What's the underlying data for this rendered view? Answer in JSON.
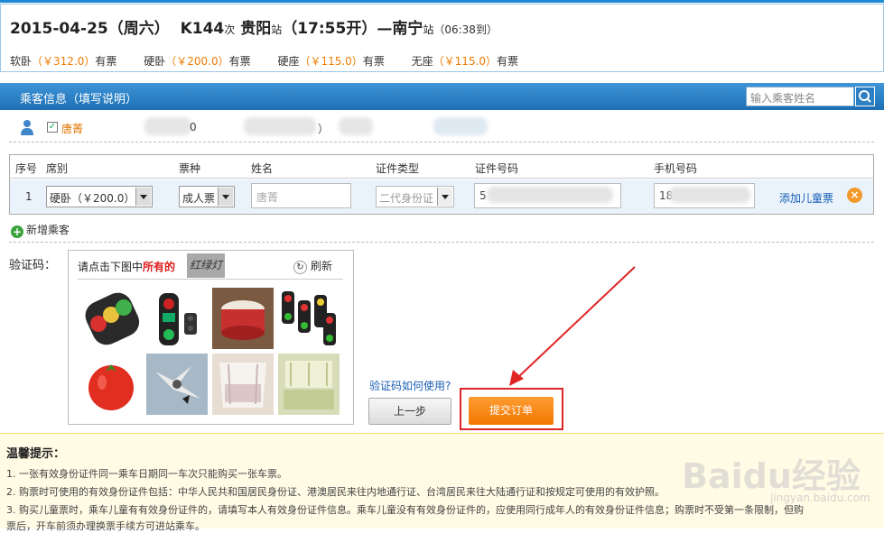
{
  "trip": {
    "date": "2015-04-25（周六）",
    "train": "K144",
    "train_suffix": "次",
    "from": "贵阳",
    "from_suffix": "站",
    "depart": "（17:55开）",
    "to_prefix": "—",
    "to": "南宁",
    "to_suffix": "站",
    "arrive": "（06:38到）"
  },
  "seats": [
    {
      "name": "软卧",
      "price": "（￥312.0）",
      "status": "有票"
    },
    {
      "name": "硬卧",
      "price": "（￥200.0）",
      "status": "有票"
    },
    {
      "name": "硬座",
      "price": "（￥115.0）",
      "status": "有票"
    },
    {
      "name": "无座",
      "price": "（￥115.0）",
      "status": "有票"
    }
  ],
  "passenger_bar": {
    "title": "乘客信息（填写说明）",
    "search_placeholder": "输入乘客姓名"
  },
  "saved_passengers": {
    "name": "唐菁",
    "fragments": [
      "0",
      "）"
    ]
  },
  "table": {
    "headers": [
      "序号",
      "席别",
      "票种",
      "姓名",
      "证件类型",
      "证件号码",
      "手机号码"
    ],
    "row": {
      "index": "1",
      "seat": "硬卧（￥200.0）",
      "ticket_type": "成人票",
      "name": "唐菁",
      "id_type": "二代身份证",
      "id_number": "5",
      "phone": "18",
      "add_child": "添加儿童票",
      "delete_icon": "×"
    }
  },
  "add_passenger": "新增乘客",
  "captcha": {
    "label": "验证码：",
    "prompt_prefix": "请点击下图中",
    "prompt_red": "所有的",
    "word": "红绿灯",
    "refresh": "刷新",
    "help": "验证码如何使用?"
  },
  "buttons": {
    "prev": "上一步",
    "submit": "提交订单"
  },
  "tips": {
    "title": "温馨提示：",
    "lines": [
      "1. 一张有效身份证件同一乘车日期同一车次只能购买一张车票。",
      "2. 购票时可使用的有效身份证件包括：中华人民共和国居民身份证、港澳居民来往内地通行证、台湾居民来往大陆通行证和按规定可使用的有效护照。",
      "3. 购买儿童票时，乘车儿童有有效身份证件的，请填写本人有效身份证件信息。乘车儿童没有有效身份证件的，应使用同行成年人的有效身份证件信息；购票时不受第一条限制，但购",
      "票后，开车前须办理换票手续方可进站乘车。"
    ]
  },
  "watermark": "Baidu经验",
  "watermark_url": "jingyan.baidu.com",
  "colors": {
    "accent_blue": "#1d6fb4",
    "price_orange": "#f07a00",
    "submit_orange": "#f27700",
    "highlight_red": "#e02525"
  }
}
